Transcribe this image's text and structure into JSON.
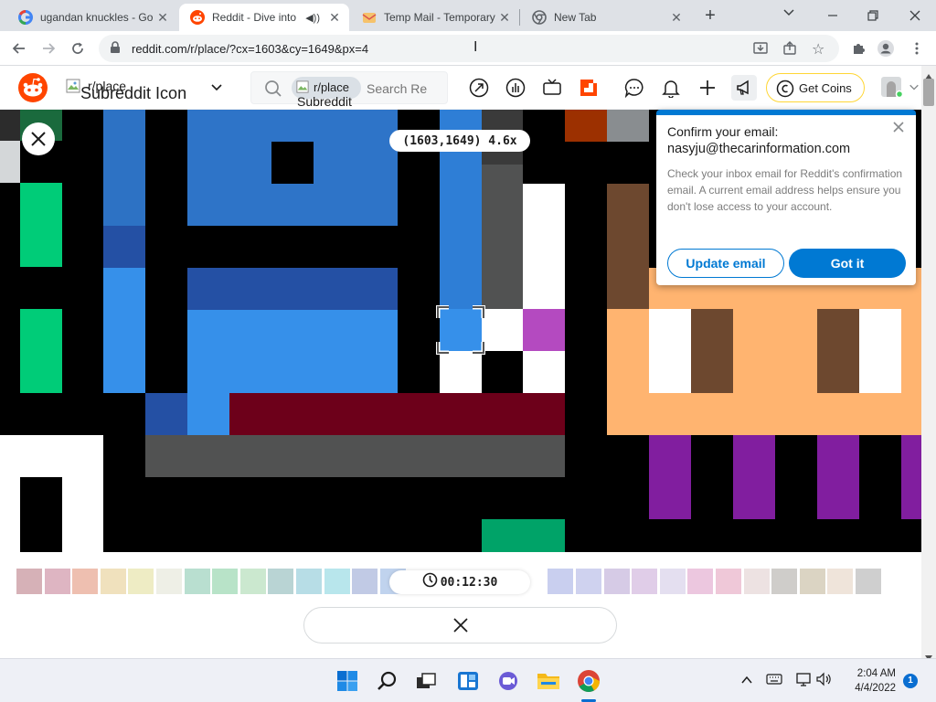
{
  "browser": {
    "tabs": [
      {
        "title": "ugandan knuckles - Go",
        "favicon": "google-icon"
      },
      {
        "title": "Reddit - Dive into",
        "favicon": "reddit-icon",
        "active": true
      },
      {
        "title": "Temp Mail - Temporary",
        "favicon": "tempmail-icon"
      },
      {
        "title": "New Tab",
        "favicon": "chrome-icon"
      }
    ],
    "url": "reddit.com/r/place/?cx=1603&cy=1649&px=4"
  },
  "reddit_header": {
    "community_label": "r/place",
    "subreddit_icon_alt": "Subreddit Icon",
    "search_community": "r/place",
    "search_icon_alt": "Subreddit Icon",
    "search_placeholder": "Search Re",
    "get_coins_label": "Get Coins"
  },
  "place": {
    "coordinates_label": "(1603,1649) 4.6x",
    "timer": "00:12:30"
  },
  "popup": {
    "title": "Confirm your email:",
    "email": "nasyju@thecarinformation.com",
    "body": "Check your inbox email for Reddit's confirmation email. A current email address helps ensure you don't lose access to your account.",
    "update_label": "Update email",
    "gotit_label": "Got it"
  },
  "taskbar": {
    "time": "2:04 AM",
    "date": "4/4/2022",
    "notification_count": "1"
  },
  "colors": {
    "reddit_orange": "#ff4500",
    "reddit_blue": "#0079d3"
  }
}
